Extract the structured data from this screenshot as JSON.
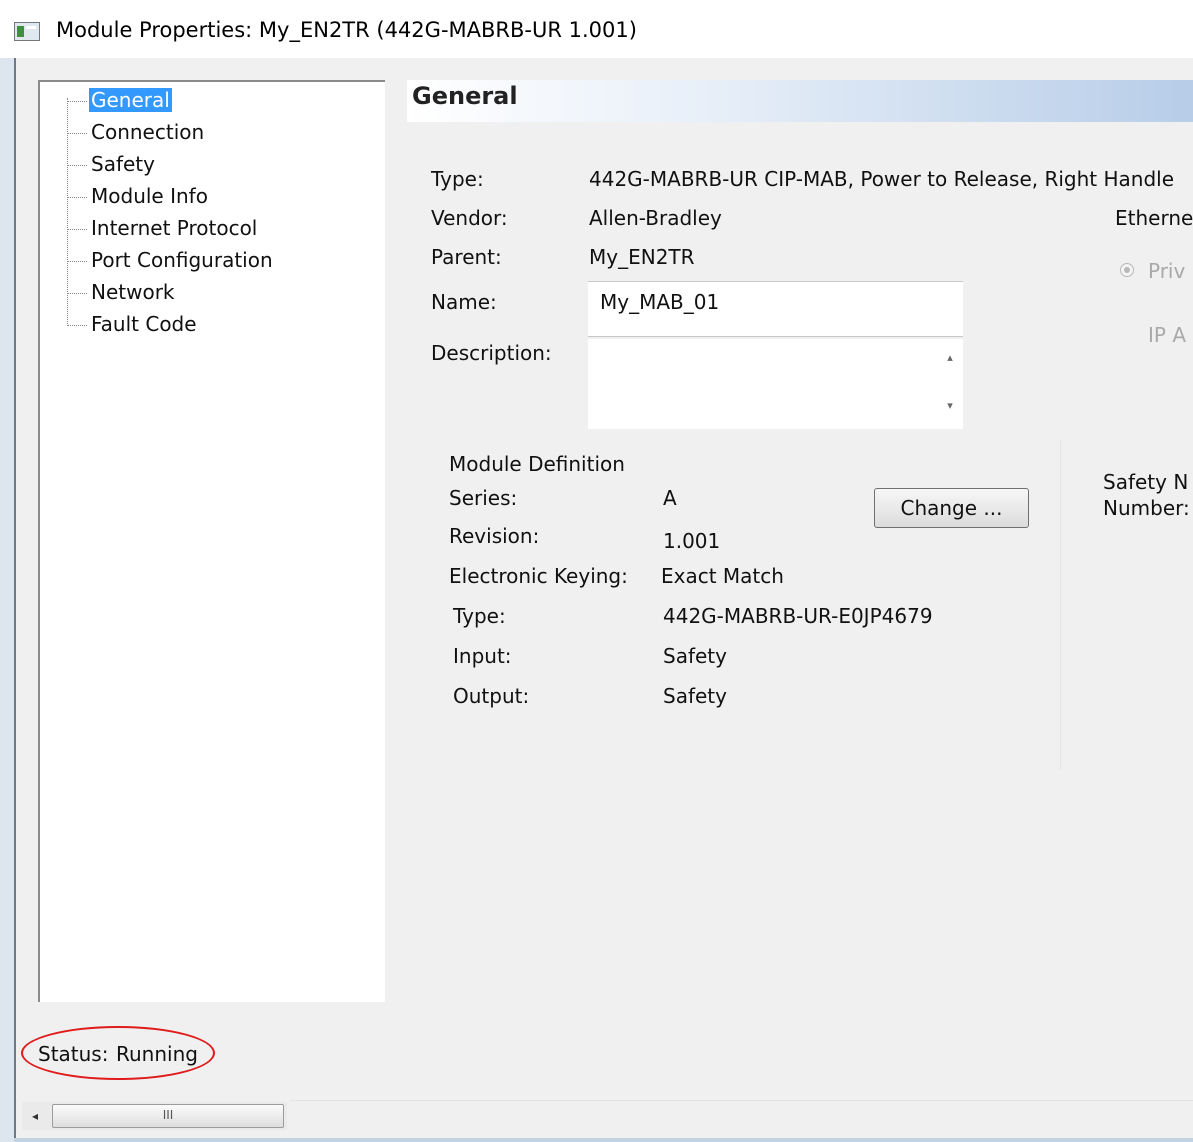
{
  "window": {
    "title": "Module Properties: My_EN2TR (442G-MABRB-UR 1.001)"
  },
  "tree": {
    "items": [
      {
        "label": "General",
        "selected": true
      },
      {
        "label": "Connection"
      },
      {
        "label": "Safety"
      },
      {
        "label": "Module Info"
      },
      {
        "label": "Internet Protocol"
      },
      {
        "label": "Port Configuration"
      },
      {
        "label": "Network"
      },
      {
        "label": "Fault Code"
      }
    ]
  },
  "panel": {
    "title": "General",
    "type_label": "Type:",
    "type_value": "442G-MABRB-UR CIP-MAB, Power to Release, Right Handle",
    "vendor_label": "Vendor:",
    "vendor_value": "Allen-Bradley",
    "parent_label": "Parent:",
    "parent_value": "My_EN2TR",
    "name_label": "Name:",
    "name_value": "My_MAB_01",
    "description_label": "Description:",
    "description_value": "",
    "ethernet_label": "Etherne",
    "private_radio_label": "Priv",
    "ip_label": "IP A",
    "safety_network_label_line1": "Safety N",
    "safety_network_label_line2": "Number:"
  },
  "module_definition": {
    "heading": "Module Definition",
    "series_label": "Series:",
    "series_value": "A",
    "revision_label": "Revision:",
    "revision_value": "1.001",
    "keying_label": "Electronic Keying:",
    "keying_value": "Exact Match",
    "type_label": "Type:",
    "type_value": "442G-MABRB-UR-E0JP4679",
    "input_label": "Input:",
    "input_value": "Safety",
    "output_label": "Output:",
    "output_value": "Safety",
    "change_button": "Change ..."
  },
  "status": {
    "label": "Status:",
    "value": "Running"
  },
  "scrollbar": {
    "thumb_grip": "III",
    "left_arrow": "◂"
  },
  "colors": {
    "selection": "#3399ff",
    "highlight_oval": "#e01b1b"
  }
}
